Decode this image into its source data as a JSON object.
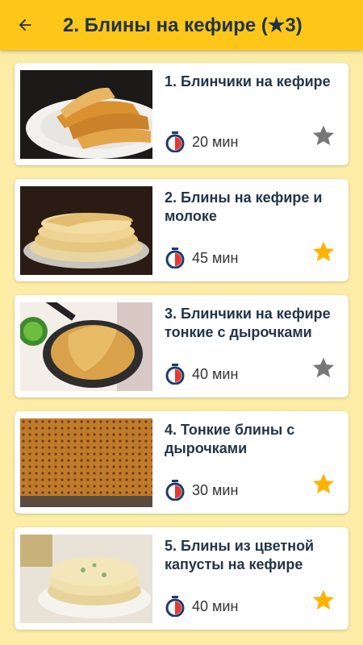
{
  "header": {
    "title": "2. Блины на кефире  (★3)",
    "back_icon": "arrow-left-icon"
  },
  "colors": {
    "appbar": "#fec619",
    "background": "#fdeca6",
    "star_active": "#ffb300",
    "star_inactive": "#777777",
    "timer_red": "#e53935",
    "timer_navy": "#1f3b6e"
  },
  "recipes": [
    {
      "title": "1. Блинчики на кефире",
      "time": "20 мин",
      "favorite": false
    },
    {
      "title": "2. Блины на кефире и молоке",
      "time": "45 мин",
      "favorite": true
    },
    {
      "title": "3. Блинчики на кефире тонкие с дырочками",
      "time": "40 мин",
      "favorite": false
    },
    {
      "title": "4. Тонкие блины с дырочками",
      "time": "30 мин",
      "favorite": true
    },
    {
      "title": "5. Блины из цветной капусты на кефире",
      "time": "40 мин",
      "favorite": true
    }
  ]
}
